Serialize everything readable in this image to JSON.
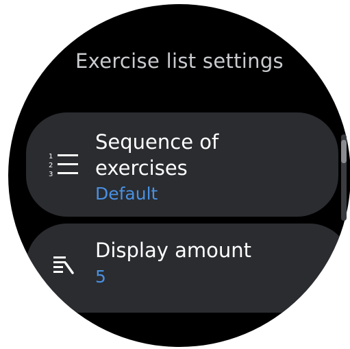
{
  "screen": {
    "title": "Exercise list settings"
  },
  "settings": [
    {
      "label": "Sequence of exercises",
      "value": "Default",
      "icon": "numbered-list-icon"
    },
    {
      "label": "Display amount",
      "value": "5",
      "icon": "lines-amount-icon"
    }
  ],
  "colors": {
    "background": "#000000",
    "card": "#2a2c30",
    "title_text": "#c9cbcf",
    "label_text": "#ffffff",
    "value_text": "#4a90e2"
  }
}
